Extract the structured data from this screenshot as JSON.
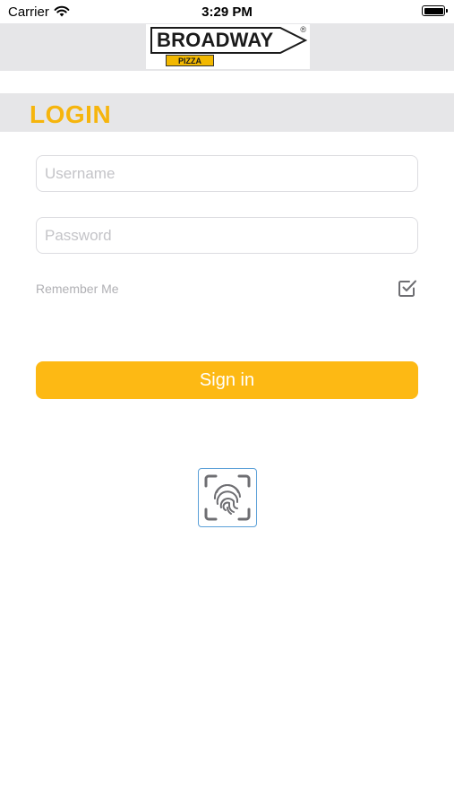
{
  "status_bar": {
    "carrier": "Carrier",
    "time": "3:29 PM",
    "icons": [
      "wifi-icon",
      "battery-icon"
    ]
  },
  "header": {
    "logo": {
      "brand": "BROADWAY",
      "sub": "PIZZA",
      "reg_mark": "®"
    }
  },
  "login": {
    "title": "LOGIN",
    "username": {
      "placeholder": "Username",
      "value": ""
    },
    "password": {
      "placeholder": "Password",
      "value": ""
    },
    "remember_label": "Remember Me",
    "remember_checked": true,
    "sign_in_label": "Sign in",
    "biometric_icon": "fingerprint-icon"
  },
  "colors": {
    "accent": "#fdb914",
    "title": "#f6b50d",
    "header_bg": "#e6e6e8",
    "touchid_border": "#5ba0d8"
  }
}
